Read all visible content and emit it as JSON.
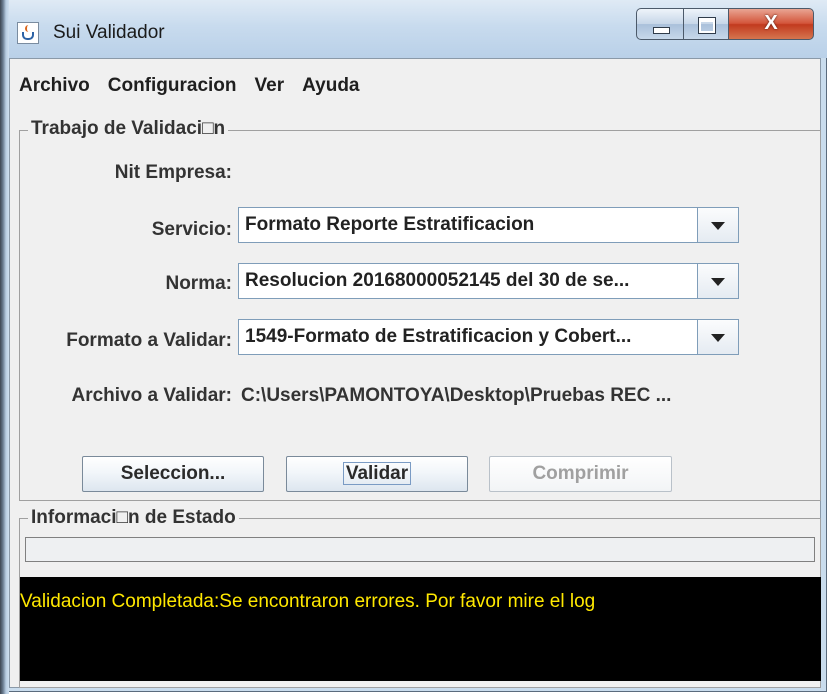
{
  "window": {
    "title": "Sui Validador",
    "close_glyph": "X"
  },
  "menu": [
    "Archivo",
    "Configuracion",
    "Ver",
    "Ayuda"
  ],
  "job_section": {
    "title": "Trabajo de Validaci□n",
    "nit_label": "Nit Empresa:",
    "nit_value": "",
    "servicio_label": "Servicio:",
    "servicio_value": "Formato Reporte Estratificacion",
    "norma_label": "Norma:",
    "norma_value": "Resolucion 20168000052145 del 30 de se...",
    "formato_label": "Formato a Validar:",
    "formato_value": "1549-Formato de Estratificacion y Cobert...",
    "archivo_label": "Archivo a Validar:",
    "archivo_value": "C:\\Users\\PAMONTOYA\\Desktop\\Pruebas REC ..."
  },
  "buttons": {
    "seleccion": "Seleccion...",
    "validar": "Validar",
    "comprimir": "Comprimir"
  },
  "status_section": {
    "title": "Informaci□n de Estado",
    "progress": 0,
    "message": "Validacion Completada:Se encontraron errores. Por favor mire el log"
  },
  "icons": {
    "app": "java-cup-icon",
    "dropdown": "chevron-down-icon"
  },
  "colors": {
    "console_bg": "#000000",
    "console_text": "#ffe800"
  }
}
